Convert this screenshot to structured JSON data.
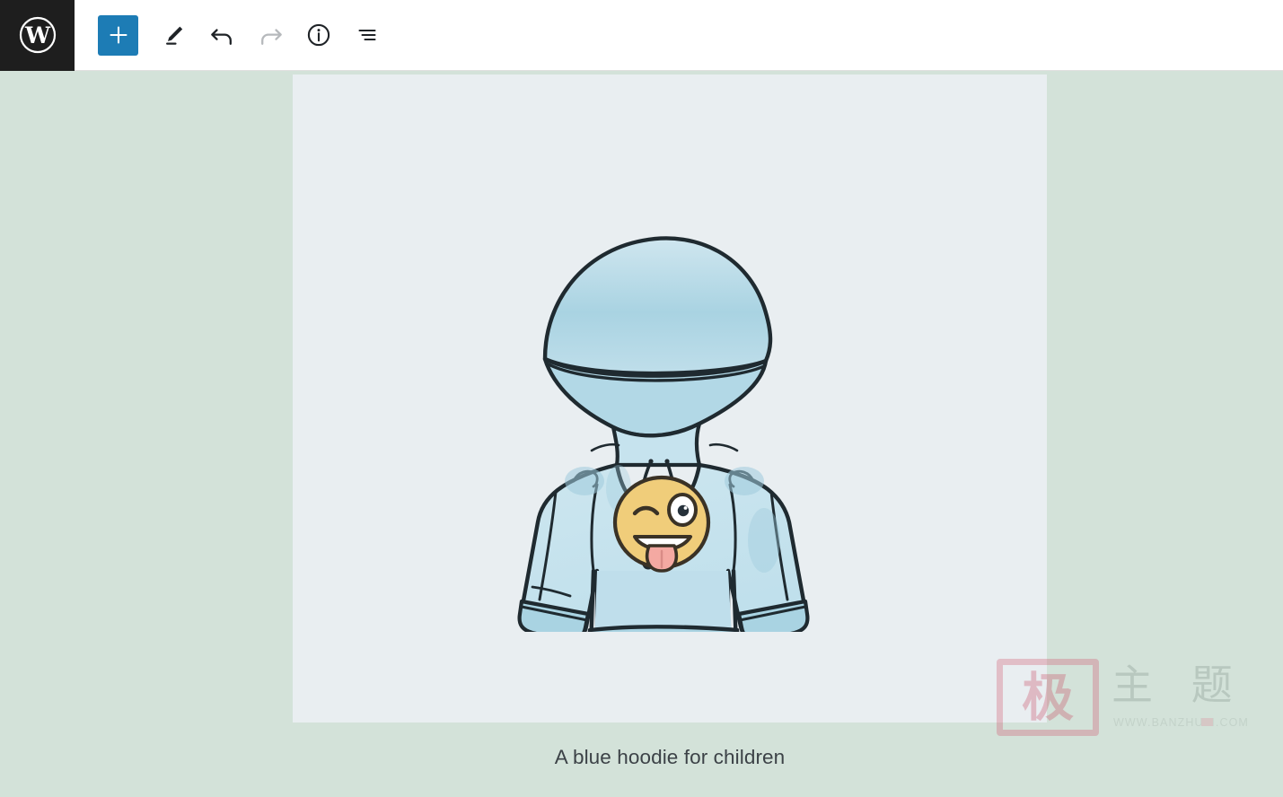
{
  "app": {
    "name": "WordPress Block Editor",
    "logo_icon": "wordpress-logo-icon",
    "logo_title": "WordPress"
  },
  "toolbar": {
    "items": [
      {
        "label": "Add block",
        "icon": "plus-icon",
        "state": "primary"
      },
      {
        "label": "Edit",
        "icon": "pencil-icon",
        "state": "active"
      },
      {
        "label": "Undo",
        "icon": "undo-arrow-icon",
        "state": "active"
      },
      {
        "label": "Redo",
        "icon": "redo-arrow-icon",
        "state": "disabled"
      },
      {
        "label": "Details",
        "icon": "info-circle-icon",
        "state": "active"
      },
      {
        "label": "List view",
        "icon": "list-view-icon",
        "state": "active"
      }
    ]
  },
  "editor": {
    "image_block": {
      "alt": "A hand drawn illustration of a light blue children's hoodie with a winking emoji print on the chest",
      "caption": "A blue hoodie for children",
      "background_color": "#e9eef1"
    },
    "canvas_background": "#d3e2d9"
  },
  "watermark": {
    "seal_char": "极",
    "chinese_text": "主 题",
    "url": "WWW.BANZHUTI.COM"
  },
  "colors": {
    "accent": "#1d7cb5",
    "admin_bar": "#1e1e1e",
    "canvas": "#d3e2d9",
    "image_bg": "#e9eef1",
    "caption_text": "#3c4247",
    "ink": "#1f2a30",
    "hoodie_fill": "#c3e0ea",
    "hoodie_shade": "#a9d3e2",
    "emoji_yellow": "#f0cd7a",
    "tongue_pink": "#f4a9a2"
  }
}
